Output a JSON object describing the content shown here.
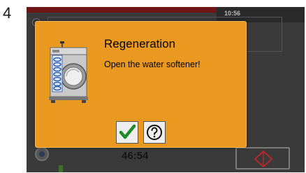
{
  "step": {
    "number": "4"
  },
  "status_bar": {
    "time": "10:56",
    "alarm_color": "#6e1515"
  },
  "background": {
    "timer": "46:54"
  },
  "dialog": {
    "title": "Regeneration",
    "message": "Open the water softener!",
    "background_color": "#ea9920",
    "icon": "water-softener-machine-icon",
    "buttons": {
      "confirm": {
        "icon": "checkmark-icon",
        "color": "#1f8a2a"
      },
      "help": {
        "icon": "question-mark-icon"
      }
    }
  }
}
